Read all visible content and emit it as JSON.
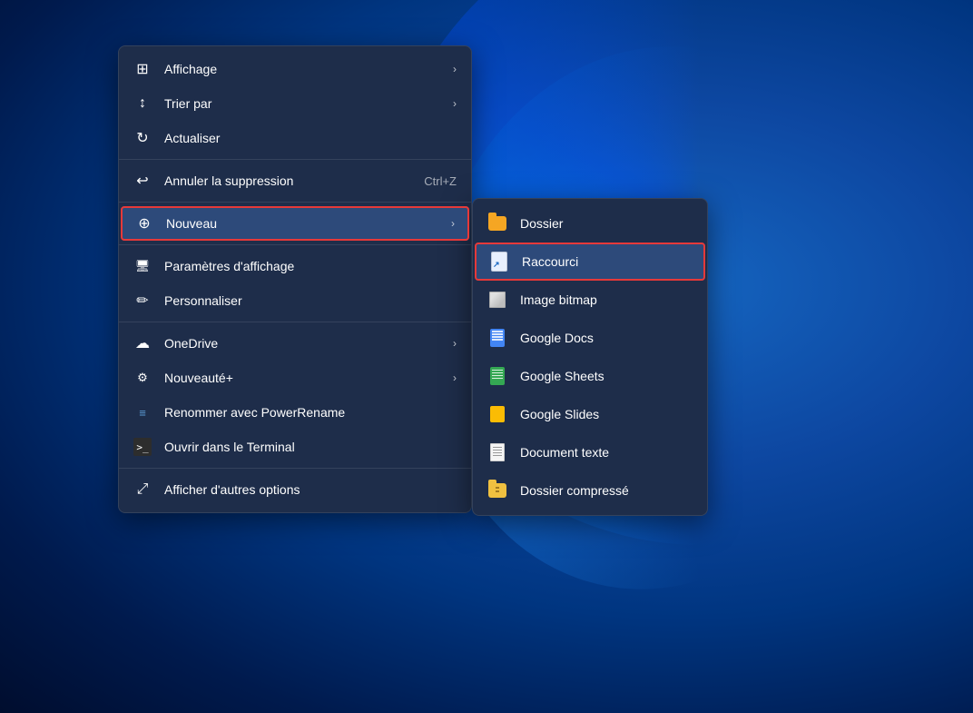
{
  "desktop": {
    "bg_color_start": "#1565c0",
    "bg_color_end": "#000d2e"
  },
  "context_menu": {
    "items": [
      {
        "id": "affichage",
        "label": "Affichage",
        "icon": "grid",
        "has_arrow": true,
        "shortcut": "",
        "separator_after": false
      },
      {
        "id": "trier_par",
        "label": "Trier par",
        "icon": "sort",
        "has_arrow": true,
        "shortcut": "",
        "separator_after": false
      },
      {
        "id": "actualiser",
        "label": "Actualiser",
        "icon": "refresh",
        "has_arrow": false,
        "shortcut": "",
        "separator_after": true
      },
      {
        "id": "annuler",
        "label": "Annuler la suppression",
        "icon": "undo",
        "has_arrow": false,
        "shortcut": "Ctrl+Z",
        "separator_after": false
      },
      {
        "id": "nouveau",
        "label": "Nouveau",
        "icon": "new",
        "has_arrow": true,
        "shortcut": "",
        "separator_after": true,
        "highlighted": true
      },
      {
        "id": "parametres",
        "label": "Paramètres d'affichage",
        "icon": "display",
        "has_arrow": false,
        "shortcut": "",
        "separator_after": false
      },
      {
        "id": "personnaliser",
        "label": "Personnaliser",
        "icon": "pen",
        "has_arrow": false,
        "shortcut": "",
        "separator_after": true
      },
      {
        "id": "onedrive",
        "label": "OneDrive",
        "icon": "cloud",
        "has_arrow": true,
        "shortcut": "",
        "separator_after": false
      },
      {
        "id": "nouveaute",
        "label": "Nouveauté+",
        "icon": "newplus",
        "has_arrow": true,
        "shortcut": "",
        "separator_after": false
      },
      {
        "id": "renommer",
        "label": "Renommer avec PowerRename",
        "icon": "rename",
        "has_arrow": false,
        "shortcut": "",
        "separator_after": false
      },
      {
        "id": "terminal",
        "label": "Ouvrir dans le Terminal",
        "icon": "terminal",
        "has_arrow": false,
        "shortcut": "",
        "separator_after": true
      },
      {
        "id": "afficher_options",
        "label": "Afficher d'autres options",
        "icon": "options",
        "has_arrow": false,
        "shortcut": "",
        "separator_after": false
      }
    ]
  },
  "submenu": {
    "items": [
      {
        "id": "dossier",
        "label": "Dossier",
        "icon": "folder",
        "highlighted": false
      },
      {
        "id": "raccourci",
        "label": "Raccourci",
        "icon": "shortcut",
        "highlighted": true
      },
      {
        "id": "bitmap",
        "label": "Image bitmap",
        "icon": "bitmap",
        "highlighted": false
      },
      {
        "id": "gdocs",
        "label": "Google Docs",
        "icon": "gdocs",
        "highlighted": false
      },
      {
        "id": "gsheets",
        "label": "Google Sheets",
        "icon": "gsheets",
        "highlighted": false
      },
      {
        "id": "gslides",
        "label": "Google Slides",
        "icon": "gslides",
        "highlighted": false
      },
      {
        "id": "textdoc",
        "label": "Document texte",
        "icon": "textdoc",
        "highlighted": false
      },
      {
        "id": "zip",
        "label": "Dossier compressé",
        "icon": "zip",
        "highlighted": false
      }
    ]
  }
}
